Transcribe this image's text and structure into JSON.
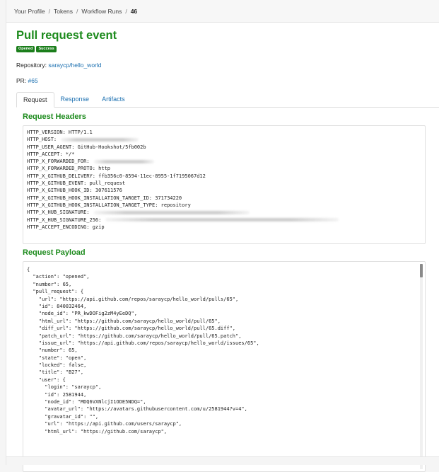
{
  "breadcrumb": {
    "items": [
      "Your Profile",
      "Tokens",
      "Workflow Runs"
    ],
    "current": "46",
    "separator": "/"
  },
  "event": {
    "title": "Pull request event",
    "badges": [
      "Opened",
      "Success"
    ],
    "repository_label": "Repository:",
    "repository_link": "saraycp/hello_world",
    "pr_label": "PR:",
    "pr_link": "#65"
  },
  "tabs": [
    {
      "label": "Request",
      "active": true
    },
    {
      "label": "Response",
      "active": false
    },
    {
      "label": "Artifacts",
      "active": false
    }
  ],
  "request_headers": {
    "heading": "Request Headers",
    "lines": [
      {
        "text": "HTTP_VERSION: HTTP/1.1",
        "redacted": false
      },
      {
        "text": "HTTP_HOST:",
        "redacted": true
      },
      {
        "text": "HTTP_USER_AGENT: GitHub-Hookshot/5fb002b",
        "redacted": false
      },
      {
        "text": "HTTP_ACCEPT: */*",
        "redacted": false
      },
      {
        "text": "HTTP_X_FORWARDED_FOR:",
        "redacted": true
      },
      {
        "text": "HTTP_X_FORWARDED_PROTO: http",
        "redacted": false
      },
      {
        "text": "HTTP_X_GITHUB_DELIVERY: ffb356c0-8594-11ec-8955-1f7195067d12",
        "redacted": false
      },
      {
        "text": "HTTP_X_GITHUB_EVENT: pull_request",
        "redacted": false
      },
      {
        "text": "HTTP_X_GITHUB_HOOK_ID: 307611576",
        "redacted": false
      },
      {
        "text": "HTTP_X_GITHUB_HOOK_INSTALLATION_TARGET_ID: 371734220",
        "redacted": false
      },
      {
        "text": "HTTP_X_GITHUB_HOOK_INSTALLATION_TARGET_TYPE: repository",
        "redacted": false
      },
      {
        "text": "HTTP_X_HUB_SIGNATURE:",
        "redacted": true
      },
      {
        "text": "HTTP_X_HUB_SIGNATURE_256:",
        "redacted": true
      },
      {
        "text": "HTTP_ACCEPT_ENCODING: gzip",
        "redacted": false
      }
    ]
  },
  "request_payload": {
    "heading": "Request Payload",
    "lines": [
      "{",
      "  \"action\": \"opened\",",
      "  \"number\": 65,",
      "  \"pull_request\": {",
      "    \"url\": \"https://api.github.com/repos/saraycp/hello_world/pulls/65\",",
      "    \"id\": 840032464,",
      "    \"node_id\": \"PR_kwDOFig2zM4yEeDQ\",",
      "    \"html_url\": \"https://github.com/saraycp/hello_world/pull/65\",",
      "    \"diff_url\": \"https://github.com/saraycp/hello_world/pull/65.diff\",",
      "    \"patch_url\": \"https://github.com/saraycp/hello_world/pull/65.patch\",",
      "    \"issue_url\": \"https://api.github.com/repos/saraycp/hello_world/issues/65\",",
      "    \"number\": 65,",
      "    \"state\": \"open\",",
      "    \"locked\": false,",
      "    \"title\": \"B27\",",
      "    \"user\": {",
      "      \"login\": \"saraycp\",",
      "      \"id\": 2581944,",
      "      \"node_id\": \"MDQ6VXNlcjI1ODE5NDQ=\",",
      "      \"avatar_url\": \"https://avatars.githubusercontent.com/u/2581944?v=4\",",
      "      \"gravatar_id\": \"\",",
      "      \"url\": \"https://api.github.com/users/saraycp\",",
      "      \"html_url\": \"https://github.com/saraycp\","
    ]
  },
  "colors": {
    "title_green": "#1d8b1d",
    "badge_green": "#1b7e1b",
    "link_blue": "#1a6fb0"
  }
}
